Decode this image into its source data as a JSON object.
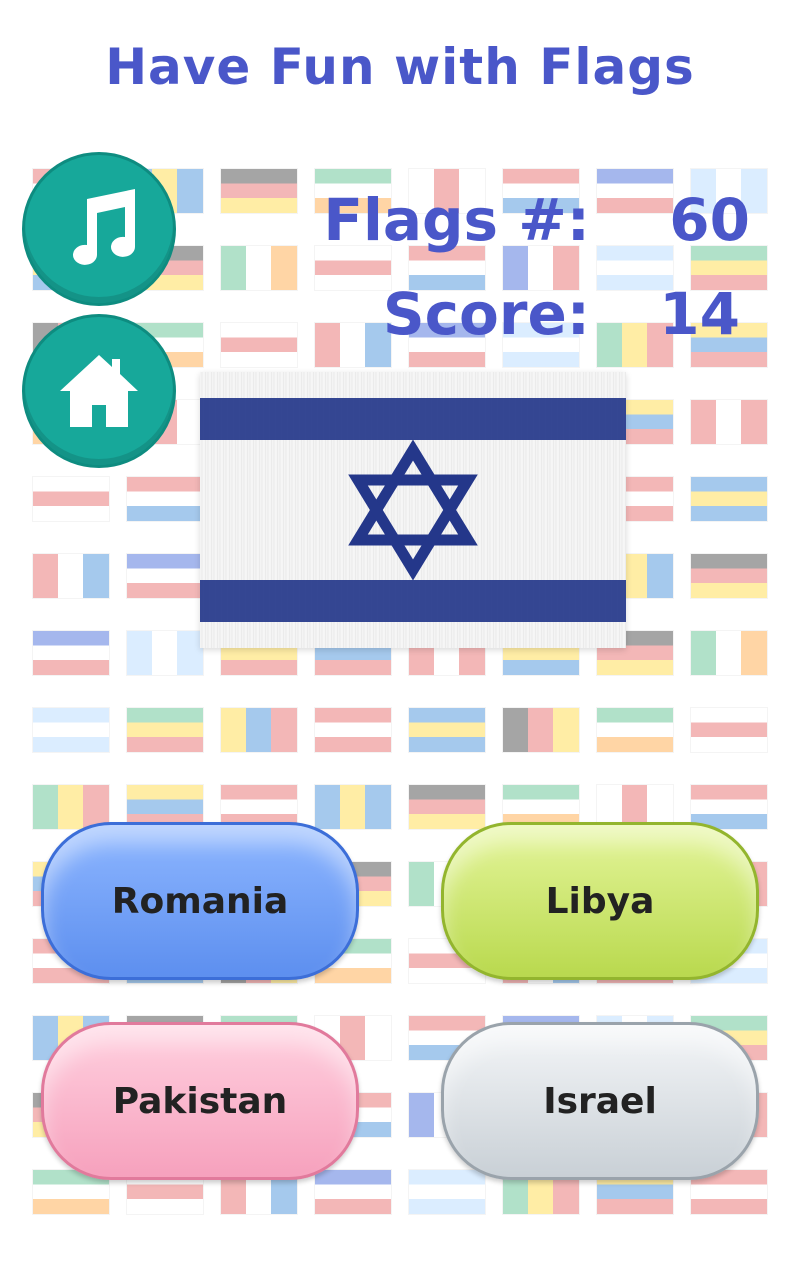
{
  "title": "Have Fun with Flags",
  "stats": {
    "flags_label": "Flags #:",
    "flags_value": "60",
    "score_label": "Score:",
    "score_value": "14"
  },
  "buttons": {
    "music_icon": "music-note-icon",
    "home_icon": "home-icon"
  },
  "question_flag": {
    "icon": "israel-flag",
    "colors": {
      "blue": "#24378a",
      "white": "#f4f4f4"
    }
  },
  "answers": [
    {
      "label": "Romania",
      "color": "#6f9cf3"
    },
    {
      "label": "Libya",
      "color": "#c8e36a"
    },
    {
      "label": "Pakistan",
      "color": "#f8b4ca"
    },
    {
      "label": "Israel",
      "color": "#dde2e7"
    }
  ],
  "theme": {
    "title_color": "#4a57c9",
    "round_button_color": "#17a89a"
  }
}
